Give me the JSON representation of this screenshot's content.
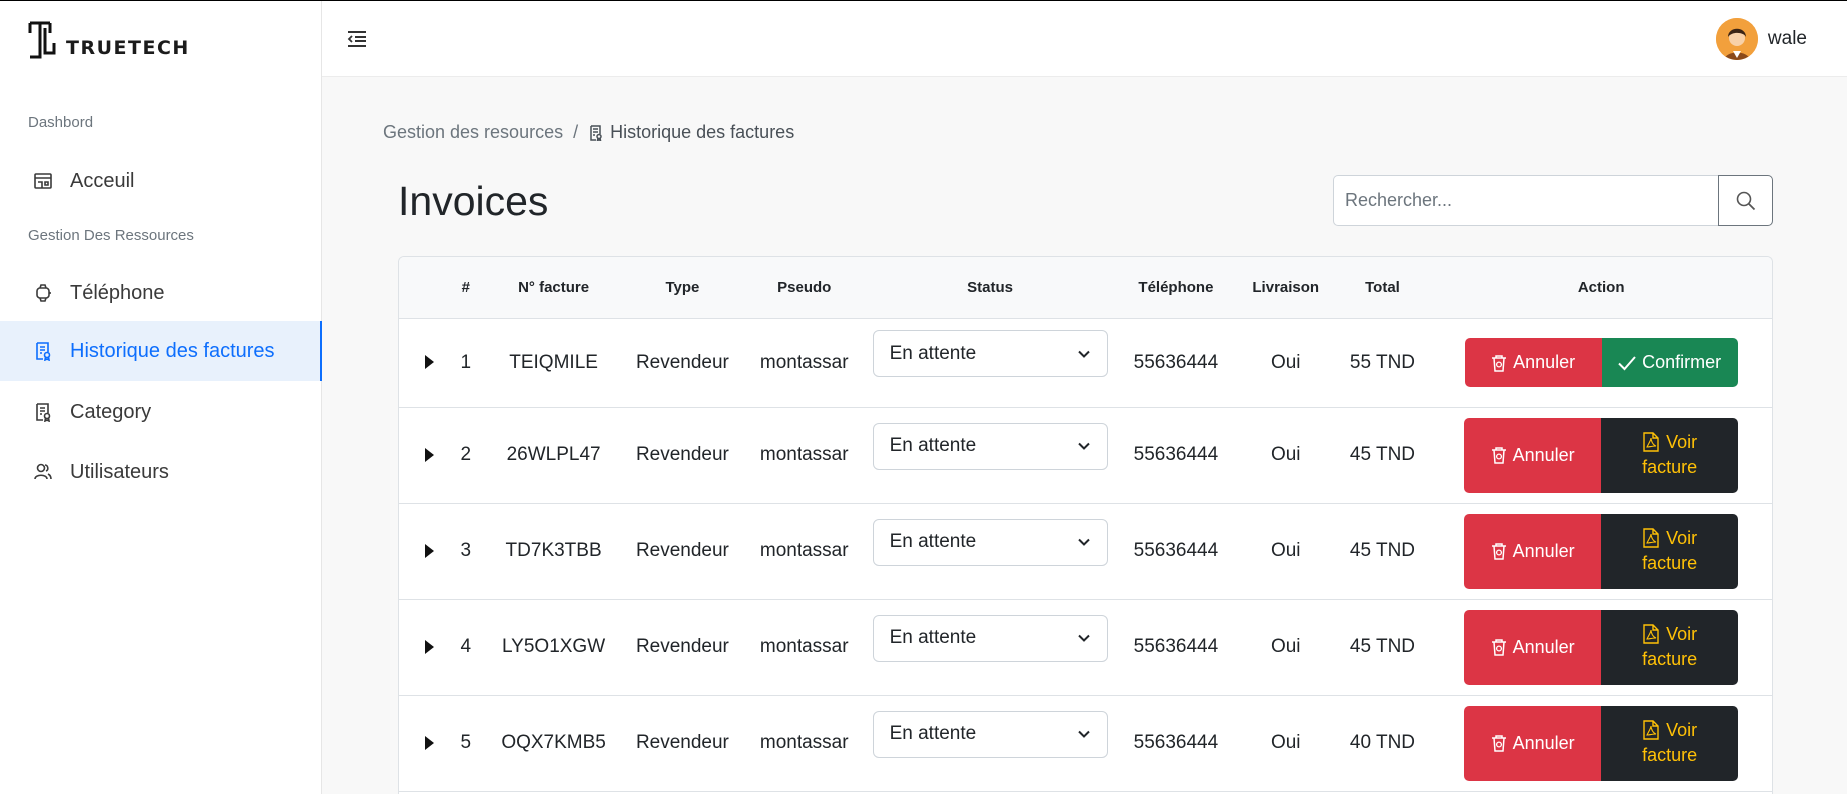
{
  "brand": {
    "name": "TRUETECH"
  },
  "sidebar": {
    "sections": [
      {
        "heading": "Dashbord"
      },
      {
        "heading": "Gestion Des Ressources"
      }
    ],
    "items": [
      {
        "label": "Acceuil",
        "icon": "store-icon"
      },
      {
        "label": "Téléphone",
        "icon": "smartwatch-icon"
      },
      {
        "label": "Historique des factures",
        "icon": "receipt-icon",
        "active": true
      },
      {
        "label": "Category",
        "icon": "receipt-icon"
      },
      {
        "label": "Utilisateurs",
        "icon": "users-icon"
      }
    ]
  },
  "header": {
    "user_name": "wale"
  },
  "breadcrumb": {
    "parent": "Gestion des resources",
    "separator": "/",
    "current": "Historique des factures"
  },
  "page": {
    "title": "Invoices"
  },
  "search": {
    "placeholder": "Rechercher..."
  },
  "table": {
    "columns": [
      "#",
      "N° facture",
      "Type",
      "Pseudo",
      "Status",
      "Téléphone",
      "Livraison",
      "Total",
      "Action"
    ],
    "rows": [
      {
        "num": "1",
        "facture": "TEIQMILE",
        "type": "Revendeur",
        "pseudo": "montassar",
        "status": "En attente",
        "telephone": "55636444",
        "livraison": "Oui",
        "total": "55 TND",
        "action": "confirm"
      },
      {
        "num": "2",
        "facture": "26WLPL47",
        "type": "Revendeur",
        "pseudo": "montassar",
        "status": "En attente",
        "telephone": "55636444",
        "livraison": "Oui",
        "total": "45 TND",
        "action": "view"
      },
      {
        "num": "3",
        "facture": "TD7K3TBB",
        "type": "Revendeur",
        "pseudo": "montassar",
        "status": "En attente",
        "telephone": "55636444",
        "livraison": "Oui",
        "total": "45 TND",
        "action": "view"
      },
      {
        "num": "4",
        "facture": "LY5O1XGW",
        "type": "Revendeur",
        "pseudo": "montassar",
        "status": "En attente",
        "telephone": "55636444",
        "livraison": "Oui",
        "total": "45 TND",
        "action": "view"
      },
      {
        "num": "5",
        "facture": "OQX7KMB5",
        "type": "Revendeur",
        "pseudo": "montassar",
        "status": "En attente",
        "telephone": "55636444",
        "livraison": "Oui",
        "total": "40 TND",
        "action": "view"
      }
    ],
    "buttons": {
      "cancel": "Annuler",
      "confirm": "Confirmer",
      "view_line1": "Voir",
      "view_line2": "facture"
    }
  },
  "colors": {
    "primary": "#0d6efd",
    "danger": "#dc3545",
    "success": "#198754",
    "dark": "#212529",
    "warning": "#ffc107"
  }
}
